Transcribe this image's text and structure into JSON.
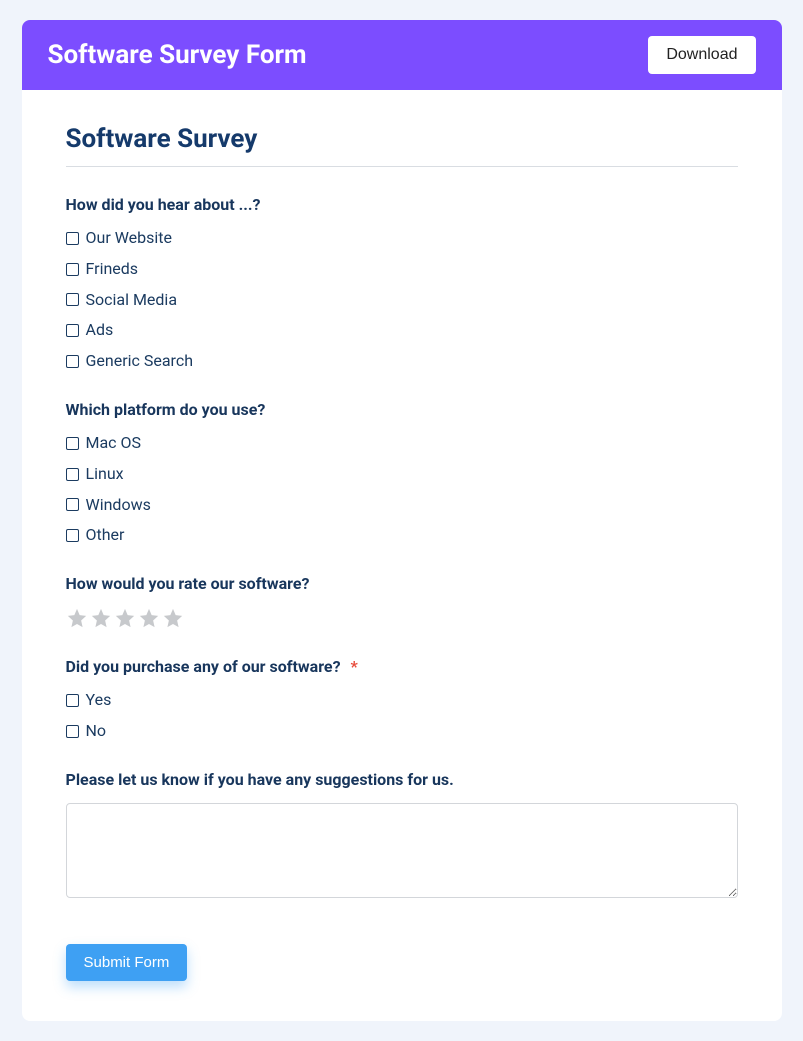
{
  "header": {
    "title": "Software Survey Form",
    "download_label": "Download"
  },
  "form": {
    "title": "Software Survey",
    "q1": {
      "label": "How did you hear about ...?",
      "options": [
        "Our Website",
        "Frineds",
        "Social Media",
        "Ads",
        "Generic Search"
      ]
    },
    "q2": {
      "label": "Which platform do you use?",
      "options": [
        "Mac OS",
        "Linux",
        "Windows",
        "Other"
      ]
    },
    "q3": {
      "label": "How would you rate our software?"
    },
    "q4": {
      "label": "Did you purchase any of our software?",
      "required_mark": "*",
      "options": [
        "Yes",
        "No"
      ]
    },
    "q5": {
      "label": "Please let us know if you have any suggestions for us."
    },
    "submit_label": "Submit Form"
  }
}
